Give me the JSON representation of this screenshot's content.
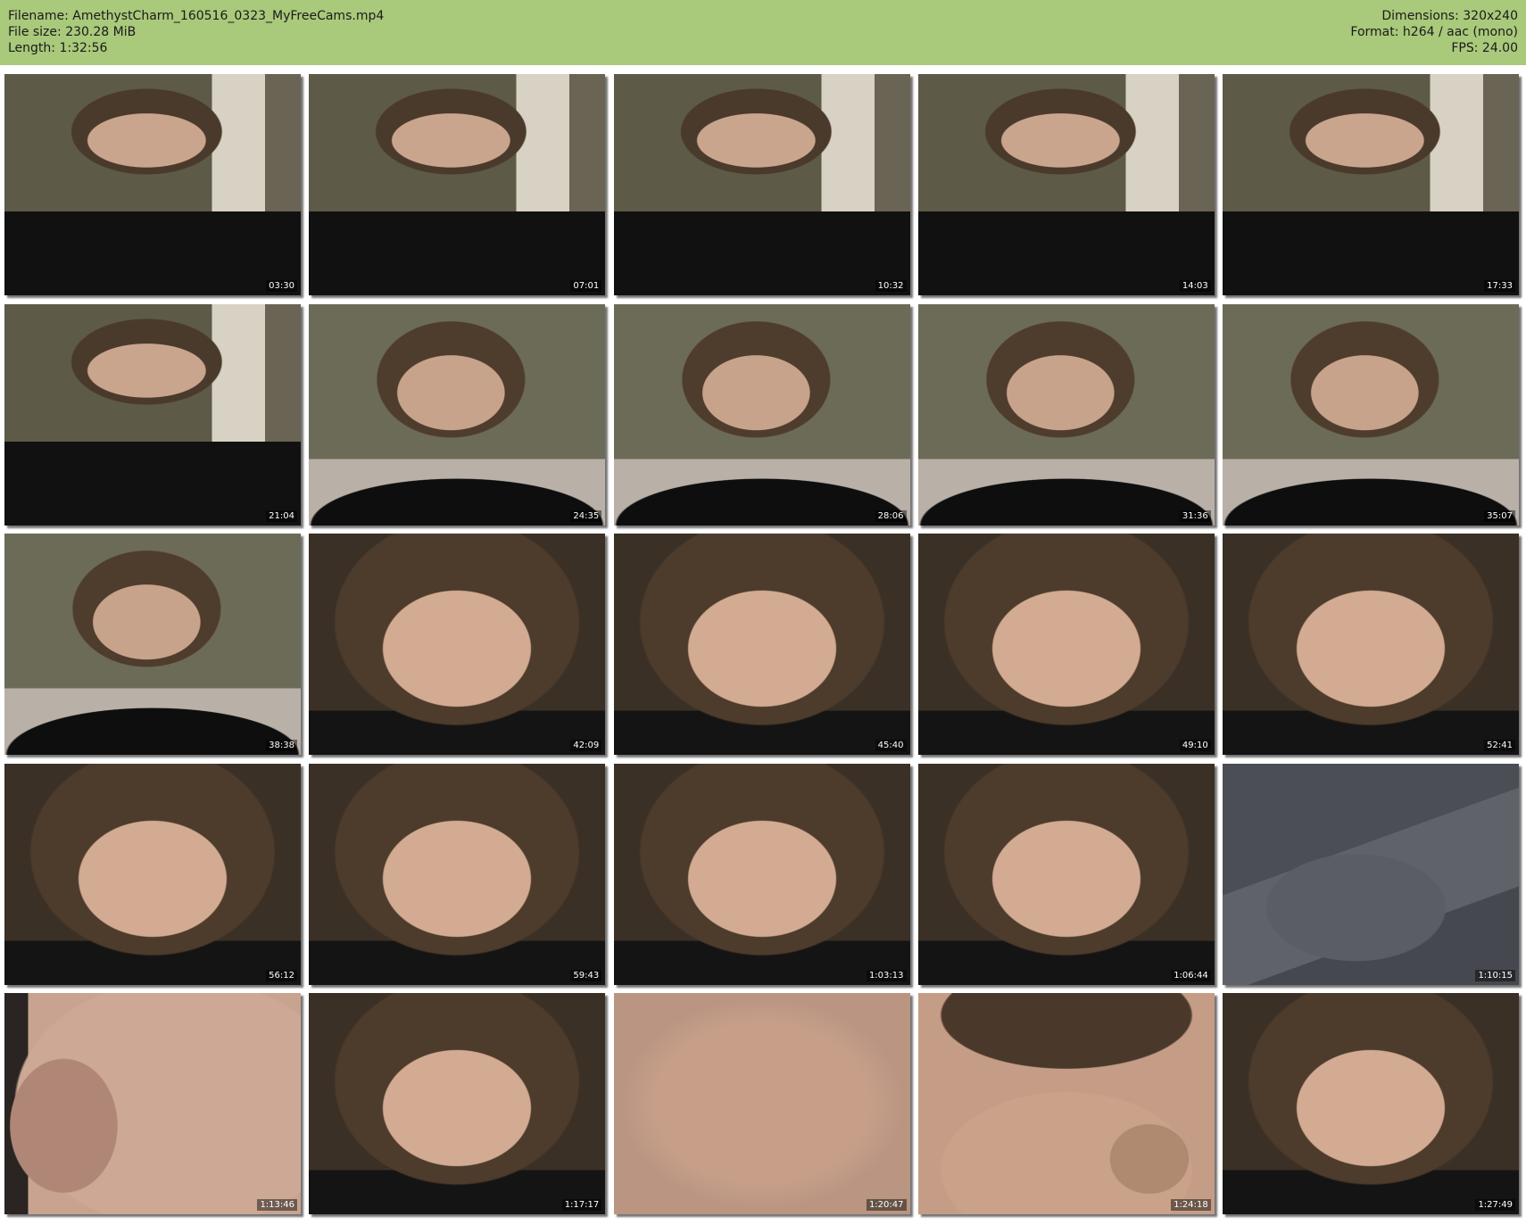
{
  "header": {
    "left": [
      "Filename: AmethystCharm_160516_0323_MyFreeCams.mp4",
      "File size: 230.28 MiB",
      "Length: 1:32:56"
    ],
    "right": [
      "Dimensions: 320x240",
      "Format: h264 / aac (mono)",
      "FPS: 24.00"
    ]
  },
  "thumbnails": [
    {
      "timestamp": "03:30",
      "scene": "room"
    },
    {
      "timestamp": "07:01",
      "scene": "room"
    },
    {
      "timestamp": "10:32",
      "scene": "room"
    },
    {
      "timestamp": "14:03",
      "scene": "room"
    },
    {
      "timestamp": "17:33",
      "scene": "room"
    },
    {
      "timestamp": "21:04",
      "scene": "room"
    },
    {
      "timestamp": "24:35",
      "scene": "mid"
    },
    {
      "timestamp": "28:06",
      "scene": "mid"
    },
    {
      "timestamp": "31:36",
      "scene": "mid"
    },
    {
      "timestamp": "35:07",
      "scene": "mid"
    },
    {
      "timestamp": "38:38",
      "scene": "mid"
    },
    {
      "timestamp": "42:09",
      "scene": "close"
    },
    {
      "timestamp": "45:40",
      "scene": "close"
    },
    {
      "timestamp": "49:10",
      "scene": "close"
    },
    {
      "timestamp": "52:41",
      "scene": "close"
    },
    {
      "timestamp": "56:12",
      "scene": "close"
    },
    {
      "timestamp": "59:43",
      "scene": "close"
    },
    {
      "timestamp": "1:03:13",
      "scene": "close"
    },
    {
      "timestamp": "1:06:44",
      "scene": "close"
    },
    {
      "timestamp": "1:10:15",
      "scene": "shirt"
    },
    {
      "timestamp": "1:13:46",
      "scene": "hand"
    },
    {
      "timestamp": "1:17:17",
      "scene": "close"
    },
    {
      "timestamp": "1:20:47",
      "scene": "skin"
    },
    {
      "timestamp": "1:24:18",
      "scene": "neck"
    },
    {
      "timestamp": "1:27:49",
      "scene": "close"
    }
  ]
}
